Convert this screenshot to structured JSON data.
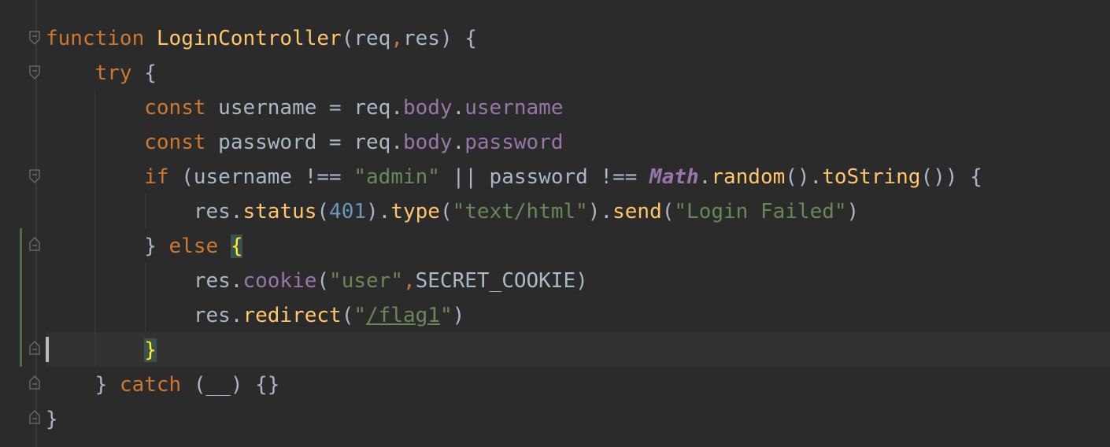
{
  "editor": {
    "colors": {
      "background": "#2b2b2b",
      "keyword": "#cc7832",
      "function": "#ffc66d",
      "string": "#6a8759",
      "number": "#6897bb",
      "property": "#9876aa",
      "text": "#a9b7c6",
      "brace_match_bg": "#3b514d",
      "brace_match_fg": "#ffef28"
    },
    "lines": [
      {
        "tokens": [
          "function",
          " ",
          "LoginController",
          "(req",
          ",",
          "res) {"
        ]
      },
      {
        "tokens": [
          "    ",
          "try",
          " {"
        ]
      },
      {
        "tokens": [
          "        ",
          "const",
          " username = req.",
          "body",
          ".",
          "username"
        ]
      },
      {
        "tokens": [
          "        ",
          "const",
          " password = req.",
          "body",
          ".",
          "password"
        ]
      },
      {
        "tokens": [
          "        ",
          "if",
          " (username !== ",
          "\"admin\"",
          " || password !== ",
          "Math",
          ".",
          "random",
          "().",
          "toString",
          "()) {"
        ]
      },
      {
        "tokens": [
          "            ",
          "res.",
          "status",
          "(",
          "401",
          ").",
          "type",
          "(",
          "\"text/html\"",
          ").",
          "send",
          "(",
          "\"Login Failed\"",
          ")"
        ]
      },
      {
        "tokens": [
          "        ",
          "} ",
          "else",
          " ",
          "{"
        ]
      },
      {
        "tokens": [
          "            ",
          "res.",
          "cookie",
          "(",
          "\"user\"",
          ",",
          "SECRET_COOKIE)"
        ]
      },
      {
        "tokens": [
          "            ",
          "res.",
          "redirect",
          "(",
          "\"",
          "/flag1",
          "\"",
          ")"
        ]
      },
      {
        "tokens": [
          "        ",
          "}"
        ]
      },
      {
        "tokens": [
          "    ",
          "} ",
          "catch",
          " (__) {}"
        ]
      },
      {
        "tokens": [
          "}"
        ]
      }
    ]
  }
}
